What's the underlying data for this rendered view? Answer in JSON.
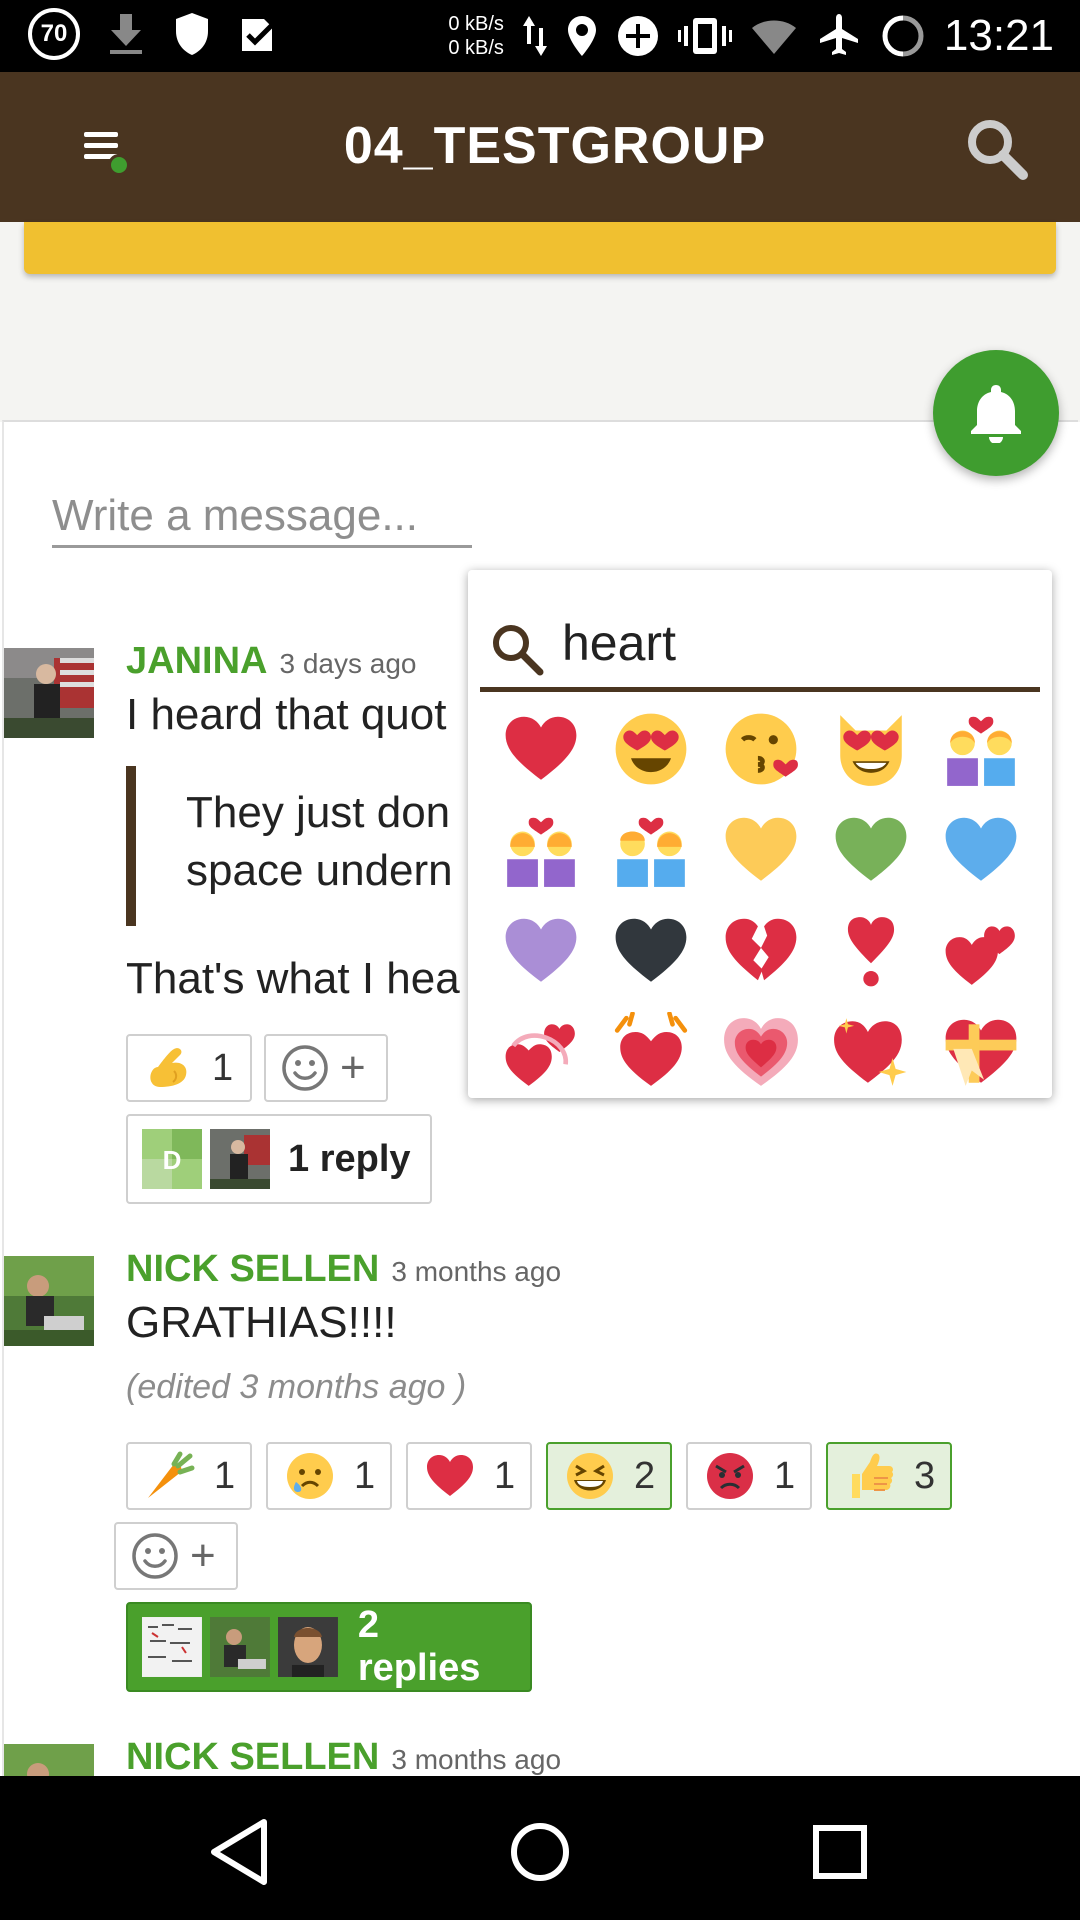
{
  "status_bar": {
    "notification_count": "70",
    "net_up": "0 kB/s",
    "net_down": "0 kB/s",
    "time": "13:21"
  },
  "app_bar": {
    "title": "04_TESTGROUP"
  },
  "composer": {
    "placeholder": "Write a message..."
  },
  "emoji_picker": {
    "search_value": "heart",
    "results": [
      "red-heart",
      "heart-eyes-face",
      "kissing-face-with-heart",
      "heart-eyes-cat",
      "couple-with-heart-women",
      "couple-with-heart-women-2",
      "couple-with-heart-man-woman",
      "yellow-heart",
      "green-heart",
      "blue-heart",
      "purple-heart",
      "black-heart",
      "broken-heart",
      "heart-exclamation",
      "two-hearts",
      "revolving-hearts",
      "beating-heart",
      "growing-heart",
      "sparkling-heart",
      "heart-with-ribbon"
    ]
  },
  "posts": [
    {
      "author": "JANINA",
      "time": "3 days ago",
      "text": "I heard that quot",
      "quote_line1": "They just don",
      "quote_line2": "space undern",
      "text2": "That's what I hea",
      "reactions": [
        {
          "emoji": "flexed-biceps",
          "count": "1"
        }
      ],
      "reply_label": "1 reply",
      "reply_avatar_letter": "D"
    },
    {
      "author": "NICK SELLEN",
      "time": "3 months ago",
      "text": "GRATHIAS!!!!",
      "edited": "(edited 3 months ago )",
      "reactions": [
        {
          "emoji": "carrot",
          "count": "1"
        },
        {
          "emoji": "crying-face",
          "count": "1"
        },
        {
          "emoji": "red-heart",
          "count": "1"
        },
        {
          "emoji": "grinning-squinting-face",
          "count": "2"
        },
        {
          "emoji": "angry-face",
          "count": "1"
        },
        {
          "emoji": "thumbs-up",
          "count": "3"
        }
      ],
      "reply_label": "2 replies"
    },
    {
      "author": "NICK SELLEN",
      "time": "3 months ago"
    }
  ],
  "colors": {
    "brand_brown": "#4a3520",
    "brand_green": "#4aa02c",
    "accent_yellow": "#f0c030"
  }
}
